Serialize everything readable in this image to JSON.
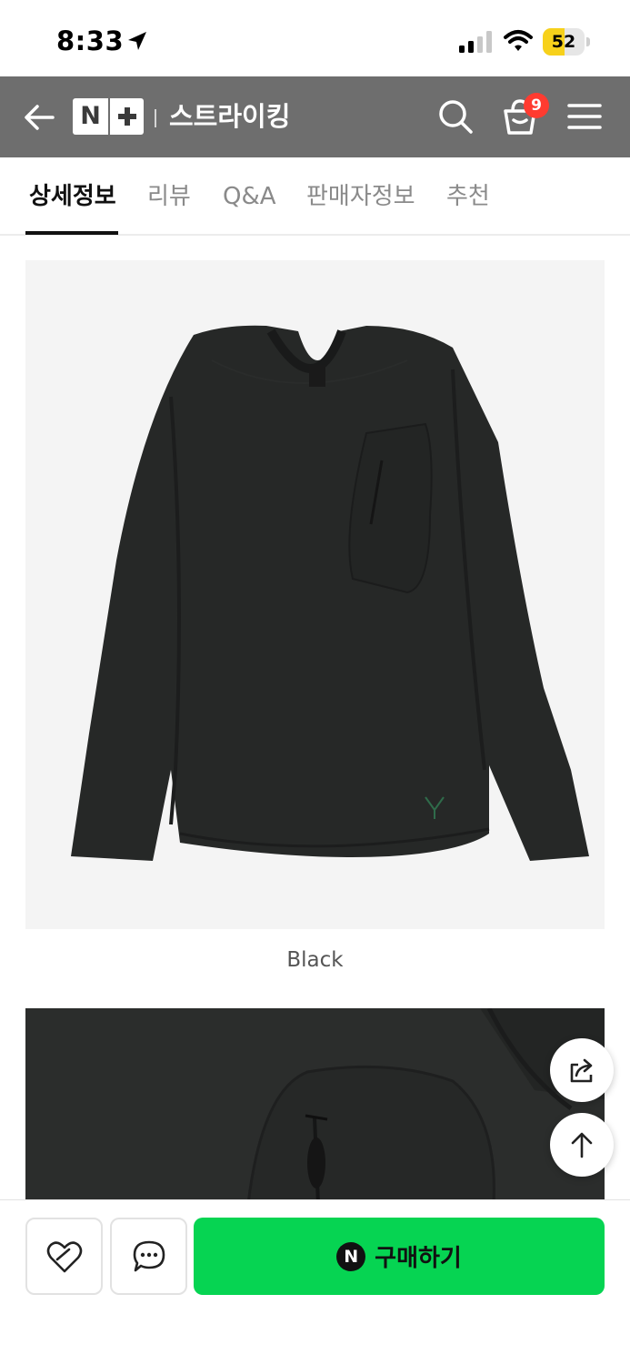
{
  "status_bar": {
    "time": "8:33",
    "battery_level": "52",
    "battery_fraction": 0.52,
    "icons": [
      "location-arrow-icon",
      "cellular-signal-icon",
      "wifi-icon",
      "battery-icon"
    ]
  },
  "app_bar": {
    "logo_text": "N",
    "store_name": "스트라이킹",
    "cart_count": "9",
    "icons": [
      "back-arrow-icon",
      "search-icon",
      "shopping-bag-icon",
      "menu-icon"
    ]
  },
  "tabs": [
    {
      "label": "상세정보",
      "active": true
    },
    {
      "label": "리뷰",
      "active": false
    },
    {
      "label": "Q&A",
      "active": false
    },
    {
      "label": "판매자정보",
      "active": false
    },
    {
      "label": "추천",
      "active": false
    }
  ],
  "product": {
    "color_caption": "Black"
  },
  "floating_buttons": [
    "share-icon",
    "scroll-top-icon"
  ],
  "bottom_bar": {
    "buy_icon_text": "N",
    "buy_label": "구매하기",
    "icons": [
      "wishlist-heart-icon",
      "chat-bubble-icon"
    ]
  },
  "colors": {
    "app_bar": "#6e6e6e",
    "buy_button": "#06d452",
    "cart_badge": "#ff3b30",
    "battery": "#f7d11b"
  }
}
